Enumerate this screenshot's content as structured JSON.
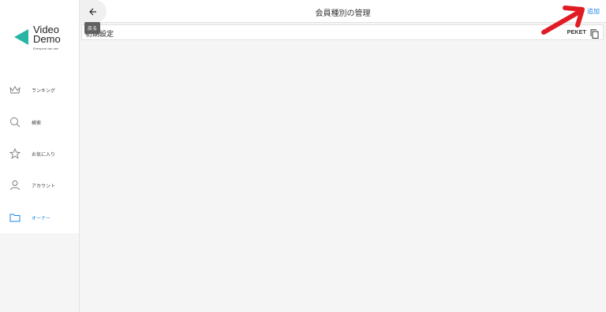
{
  "brand": {
    "name_line1": "Video",
    "name_line2": "Demo",
    "tagline": "Everyone can use"
  },
  "nav": {
    "items": [
      {
        "label": "ランキング",
        "icon": "crown-icon"
      },
      {
        "label": "検索",
        "icon": "search-icon"
      },
      {
        "label": "お気に入り",
        "icon": "star-icon"
      },
      {
        "label": "アカウント",
        "icon": "person-icon"
      },
      {
        "label": "オーナー",
        "icon": "folder-icon",
        "active": true
      }
    ]
  },
  "header": {
    "title": "会員種別の管理",
    "add_label": "追加",
    "back_tooltip": "戻る"
  },
  "membership_types": [
    {
      "label": "初期設定",
      "code": "PEKET"
    }
  ],
  "colors": {
    "accent": "#1e88e5",
    "logo": "#26b5a5",
    "annotation_arrow": "#e01b24"
  }
}
